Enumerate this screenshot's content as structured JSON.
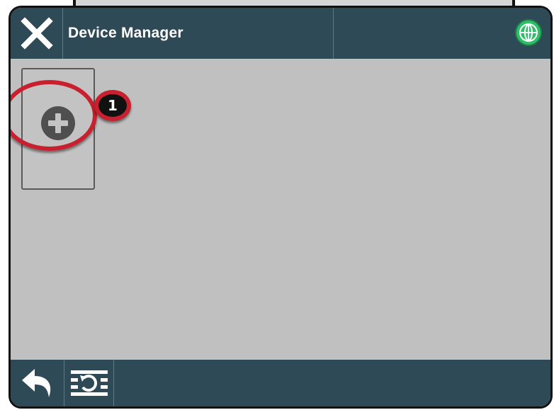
{
  "header": {
    "title": "Device Manager",
    "close_icon": "close-icon",
    "status_icon": "globe-icon"
  },
  "content": {
    "add_tile_icon": "plus-circle-icon",
    "callout_number": "1"
  },
  "footer": {
    "back_icon": "back-arrow-icon",
    "sync_icon": "refresh-icon"
  },
  "colors": {
    "bar": "#2f4a57",
    "content_bg": "#c0c0c0",
    "callout": "#c8202f",
    "globe": "#2fbf6a"
  }
}
